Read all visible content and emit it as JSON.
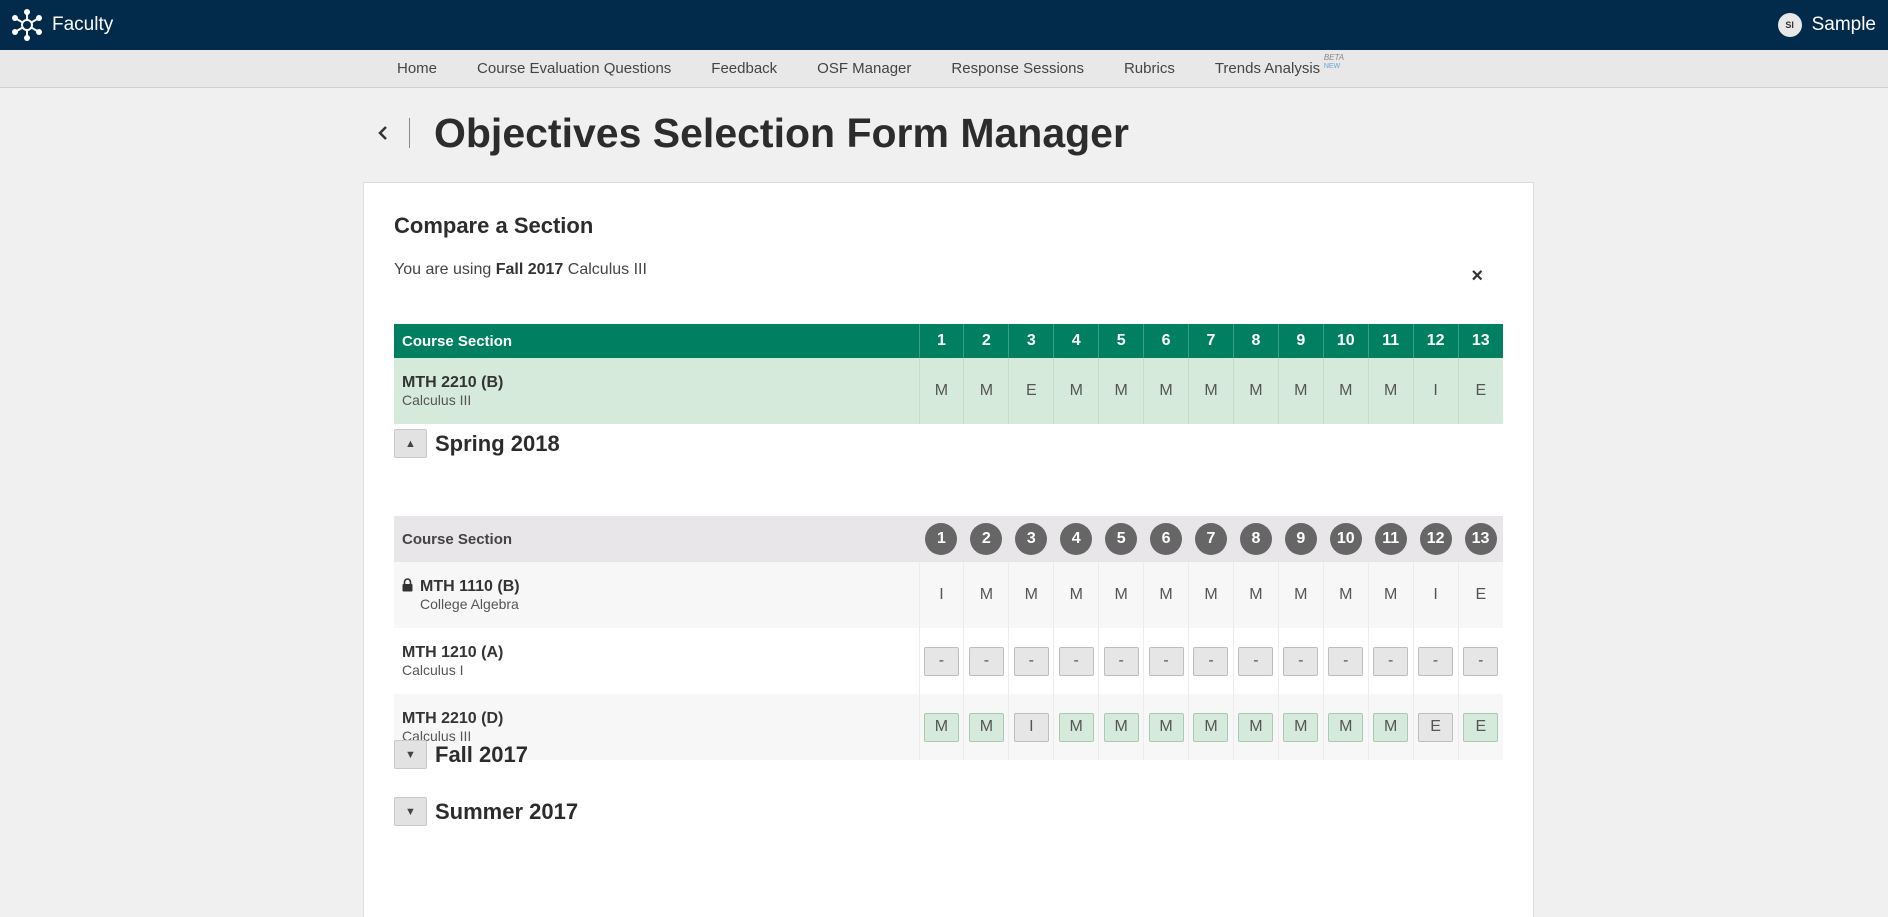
{
  "app": {
    "brand": "Faculty",
    "user": "Sample",
    "user_initials": "SI"
  },
  "nav": [
    {
      "label": "Home"
    },
    {
      "label": "Course Evaluation Questions"
    },
    {
      "label": "Feedback"
    },
    {
      "label": "OSF Manager"
    },
    {
      "label": "Response Sessions"
    },
    {
      "label": "Rubrics"
    },
    {
      "label": "Trends Analysis",
      "beta": "BETA",
      "new": "NEW"
    }
  ],
  "page": {
    "title": "Objectives Selection Form Manager"
  },
  "compare": {
    "heading": "Compare a Section",
    "using_prefix": "You are using",
    "using_term": "Fall 2017",
    "using_course": "Calculus III",
    "close_icon": "×",
    "header_label": "Course Section",
    "columns": [
      "1",
      "2",
      "3",
      "4",
      "5",
      "6",
      "7",
      "8",
      "9",
      "10",
      "11",
      "12",
      "13"
    ],
    "current": {
      "code": "MTH 2210 (B)",
      "name": "Calculus III",
      "values": [
        "M",
        "M",
        "E",
        "M",
        "M",
        "M",
        "M",
        "M",
        "M",
        "M",
        "M",
        "I",
        "E"
      ]
    }
  },
  "terms": [
    {
      "title": "Spring 2018",
      "expanded": true,
      "toggle_icon": "▲",
      "header_label": "Course Section",
      "rows": [
        {
          "code": "MTH 1110 (B)",
          "name": "College Algebra",
          "locked": true,
          "values": [
            "I",
            "M",
            "M",
            "M",
            "M",
            "M",
            "M",
            "M",
            "M",
            "M",
            "M",
            "I",
            "E"
          ]
        },
        {
          "code": "MTH 1210 (A)",
          "name": "Calculus I",
          "locked": false,
          "values": [
            "-",
            "-",
            "-",
            "-",
            "-",
            "-",
            "-",
            "-",
            "-",
            "-",
            "-",
            "-",
            "-"
          ]
        },
        {
          "code": "MTH 2210 (D)",
          "name": "Calculus III",
          "locked": false,
          "values": [
            "M",
            "M",
            "I",
            "M",
            "M",
            "M",
            "M",
            "M",
            "M",
            "M",
            "M",
            "E",
            "E"
          ],
          "match": [
            true,
            true,
            false,
            true,
            true,
            true,
            true,
            true,
            true,
            true,
            true,
            false,
            true
          ]
        }
      ]
    },
    {
      "title": "Fall 2017",
      "expanded": false,
      "toggle_icon": "▼"
    },
    {
      "title": "Summer 2017",
      "expanded": false,
      "toggle_icon": "▼"
    }
  ],
  "colors": {
    "topbar": "#022a4a",
    "green": "#008061",
    "match_bg": "#d6eadb"
  }
}
